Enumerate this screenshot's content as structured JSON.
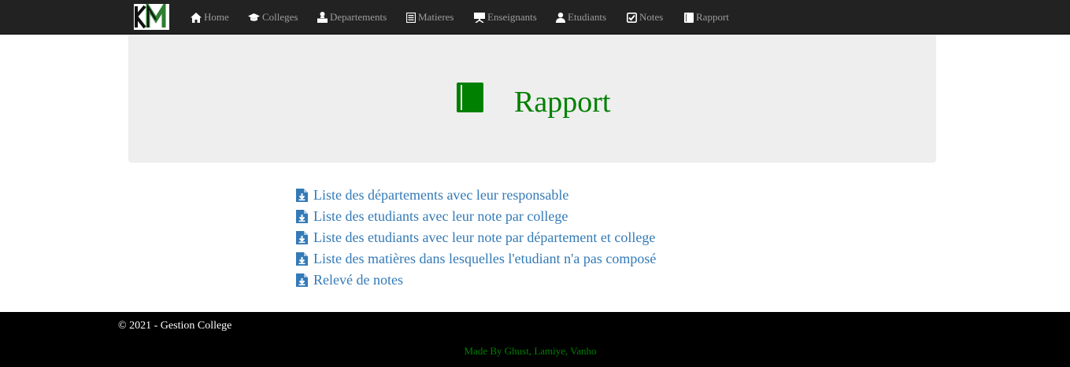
{
  "navbar": {
    "items": [
      {
        "label": "Home",
        "icon": "home-icon"
      },
      {
        "label": "Colleges",
        "icon": "graduation-cap-icon"
      },
      {
        "label": "Departements",
        "icon": "user-desk-icon"
      },
      {
        "label": "Matieres",
        "icon": "list-icon"
      },
      {
        "label": "Enseignants",
        "icon": "blackboard-icon"
      },
      {
        "label": "Etudiants",
        "icon": "user-icon"
      },
      {
        "label": "Notes",
        "icon": "check-icon"
      },
      {
        "label": "Rapport",
        "icon": "book-icon"
      }
    ]
  },
  "jumbotron": {
    "title": "Rapport",
    "icon": "book-icon"
  },
  "reports": {
    "items": [
      {
        "label": "Liste des départements avec leur responsable"
      },
      {
        "label": "Liste des etudiants avec leur note par college"
      },
      {
        "label": "Liste des etudiants avec leur note par département et college"
      },
      {
        "label": "Liste des matières dans lesquelles l'etudiant n'a pas composé"
      },
      {
        "label": "Relevé de notes"
      }
    ]
  },
  "footer": {
    "copyright": "© 2021 - Gestion College",
    "made_by": "Made By Ghust, Lamiye, Vanho"
  },
  "colors": {
    "navbar_bg": "#222222",
    "nav_text": "#9d9d9d",
    "accent_green": "#008000",
    "link_blue": "#337ab7",
    "jumbotron_bg": "#eeeeee",
    "footer_bg": "#000000"
  }
}
